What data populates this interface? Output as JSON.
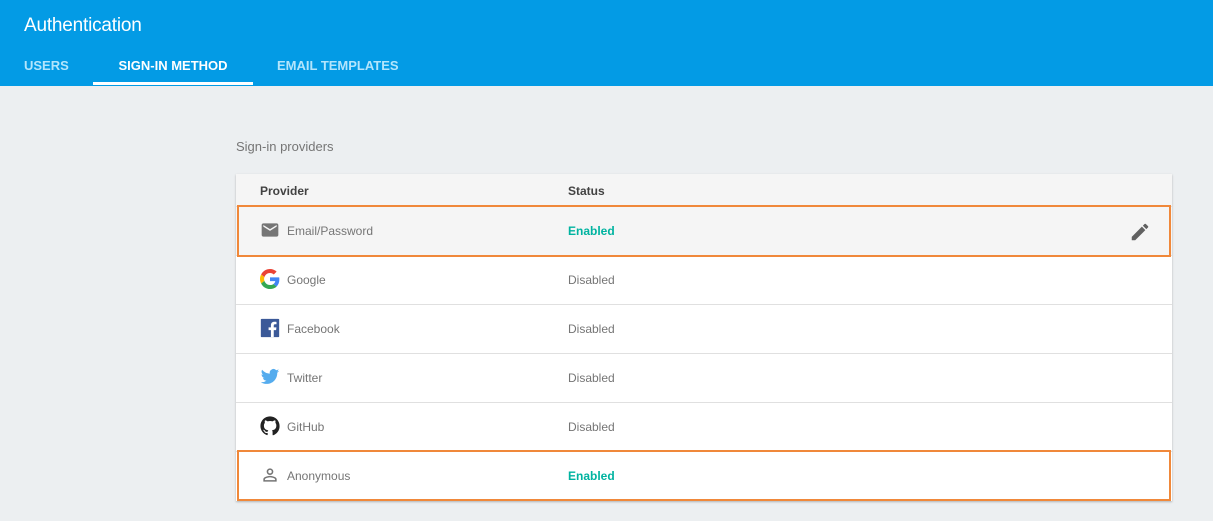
{
  "header": {
    "title": "Authentication",
    "tabs": [
      {
        "label": "USERS",
        "active": false
      },
      {
        "label": "SIGN-IN METHOD",
        "active": true
      },
      {
        "label": "EMAIL TEMPLATES",
        "active": false
      }
    ]
  },
  "section": {
    "label": "Sign-in providers"
  },
  "table": {
    "columns": [
      "Provider",
      "Status"
    ],
    "rows": [
      {
        "provider": "Email/Password",
        "status": "Enabled",
        "icon": "email-icon",
        "highlighted": true,
        "editable": true
      },
      {
        "provider": "Google",
        "status": "Disabled",
        "icon": "google-icon"
      },
      {
        "provider": "Facebook",
        "status": "Disabled",
        "icon": "facebook-icon"
      },
      {
        "provider": "Twitter",
        "status": "Disabled",
        "icon": "twitter-icon"
      },
      {
        "provider": "GitHub",
        "status": "Disabled",
        "icon": "github-icon"
      },
      {
        "provider": "Anonymous",
        "status": "Enabled",
        "icon": "person-icon"
      }
    ]
  },
  "colors": {
    "header_bg": "#039be5",
    "enabled": "#00b3a0",
    "callout": "#f0883a"
  }
}
